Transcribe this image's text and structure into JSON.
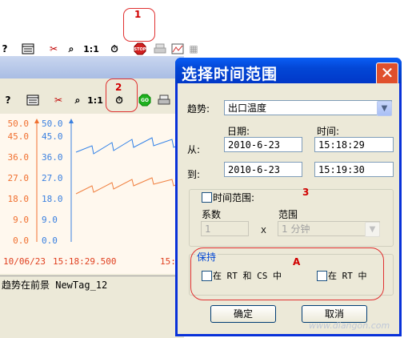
{
  "annotations": {
    "n1": "1",
    "n2": "2",
    "n3": "3",
    "nA": "A"
  },
  "top_toolbar": {
    "zoom_label": "1:1"
  },
  "trend_window": {
    "toolbar_zoom_label": "1:1",
    "left_axis_ticks": [
      "50.0",
      "45.0",
      "36.0",
      "27.0",
      "18.0",
      "9.0",
      "0.0"
    ],
    "right_axis_ticks": [
      "50.0",
      "45.0",
      "36.0",
      "27.0",
      "18.0",
      "9.0",
      "0.0"
    ],
    "time_date": "10/06/23",
    "time_start": "15:18:29.500",
    "time_cut": "15:",
    "status_text": "趋势在前景 NewTag_12",
    "colors": {
      "left_axis": "#f07030",
      "right_axis": "#3a80e0",
      "series_blue": "#2f80e8",
      "series_orange": "#f08040"
    }
  },
  "dialog": {
    "title": "选择时间范围",
    "trend_label": "趋势:",
    "trend_value": "出口温度",
    "date_header": "日期:",
    "time_header": "时间:",
    "from_label": "从:",
    "from_date": "2010-6-23",
    "from_time": "15:18:29",
    "to_label": "到:",
    "to_date": "2010-6-23",
    "to_time": "15:19:30",
    "time_range_checkbox": "时间范围:",
    "coef_label": "系数",
    "coef_value": "1",
    "x_label": "X",
    "range_label": "范围",
    "range_value": "1 分钟",
    "keep_group": "保持",
    "keep_rt_cs": "在 RT 和 CS 中",
    "keep_rt": "在 RT 中",
    "ok_button": "确定",
    "cancel_button": "取消"
  },
  "watermark": "www.diangon.com"
}
